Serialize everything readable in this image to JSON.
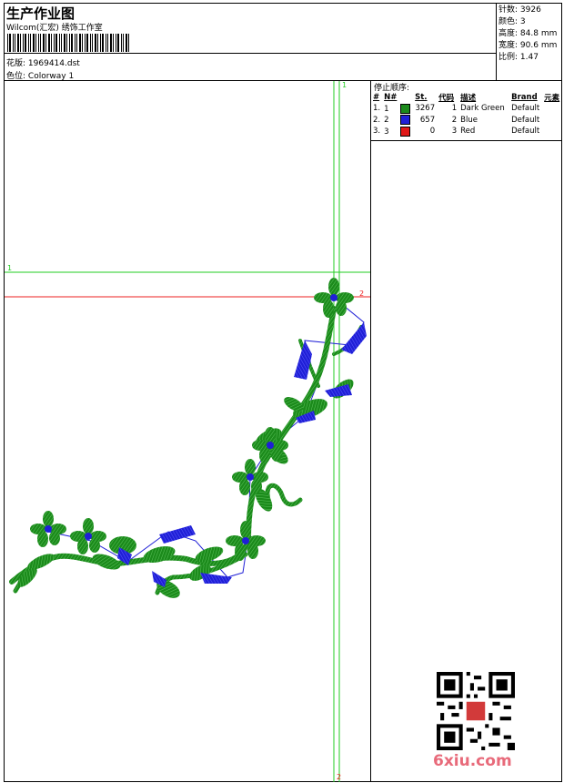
{
  "header": {
    "title": "生产作业图",
    "subtitle": "Wilcom(汇宏) 绣饰工作室",
    "design_label": "花版:",
    "design_value": "1969414.dst",
    "colorway_label": "色位:",
    "colorway_value": "Colorway 1"
  },
  "stats": {
    "stitches": {
      "label": "针数:",
      "value": "3926"
    },
    "colors": {
      "label": "颜色:",
      "value": "3"
    },
    "height": {
      "label": "高度:",
      "value": "84.8 mm"
    },
    "width": {
      "label": "宽度:",
      "value": "90.6 mm"
    },
    "scale": {
      "label": "比例:",
      "value": "1.47"
    }
  },
  "sequence": {
    "title": "停止顺序:",
    "headers": [
      "#",
      "N#",
      "St.",
      "代码",
      "描述",
      "Brand",
      "元素"
    ],
    "rows": [
      {
        "idx": "1.",
        "n": "1",
        "color": "#1b8a1b",
        "st": "3267",
        "code": "1",
        "desc": "Dark Green",
        "brand": "Default"
      },
      {
        "idx": "2.",
        "n": "2",
        "color": "#1f1fd6",
        "st": "657",
        "code": "2",
        "desc": "Blue",
        "brand": "Default"
      },
      {
        "idx": "3.",
        "n": "3",
        "color": "#e01818",
        "st": "0",
        "code": "3",
        "desc": "Red",
        "brand": "Default"
      }
    ]
  },
  "guides": {
    "v1": "1",
    "h1": "1",
    "h2": "2",
    "v2": "2"
  },
  "watermark": "6xiu.com",
  "colors": {
    "green_thread": "#1b8a1b",
    "blue_thread": "#1f1fd6",
    "guide_green": "#22cc22",
    "guide_red": "#ee2222"
  }
}
